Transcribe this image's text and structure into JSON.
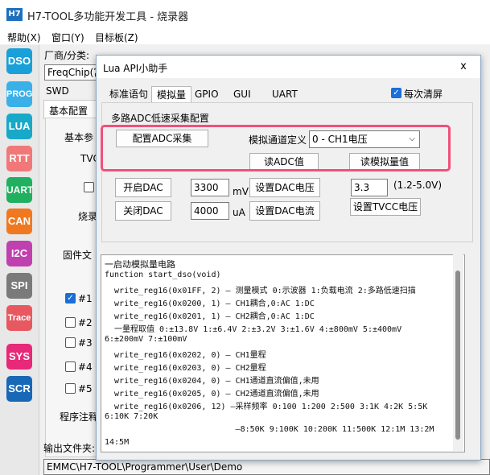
{
  "window": {
    "icon_text": "H7",
    "title": "H7-TOOL多功能开发工具 - 烧录器"
  },
  "menu": [
    "帮助(X)",
    "窗口(Y)",
    "目标板(Z)"
  ],
  "toolbar": [
    {
      "label": "DSO",
      "color": "#1aa0d8"
    },
    {
      "label": "PROG",
      "color": "#3ab0e8"
    },
    {
      "label": "LUA",
      "color": "#18a8c8"
    },
    {
      "label": "RTT",
      "color": "#f07878"
    },
    {
      "label": "UART",
      "color": "#20b060"
    },
    {
      "label": "CAN",
      "color": "#f07820"
    },
    {
      "label": "I2C",
      "color": "#c040b0"
    },
    {
      "label": "SPI",
      "color": "#7a7a7a"
    },
    {
      "label": "Trace",
      "color": "#e85860"
    },
    {
      "label": "SYS",
      "color": "#e82878"
    },
    {
      "label": "SCR",
      "color": "#1868b8"
    }
  ],
  "background": {
    "vendor_label": "厂商/分类:",
    "vendor_value": "FreqChip(富",
    "swd": "SWD",
    "basic_config_tab": "基本配置",
    "basic_param": "基本参",
    "tvc": "TVC",
    "burn": "烧录",
    "firmware": "固件文",
    "items": [
      "#1",
      "#2",
      "#3",
      "#4",
      "#5"
    ],
    "program_note": "程序注释",
    "output_folder": "输出文件夹:",
    "path": "EMMC\\H7-TOOL\\Programmer\\User\\Demo"
  },
  "dialog": {
    "title": "Lua API小助手",
    "close": "x",
    "tabs": [
      "标准语句",
      "模拟量",
      "GPIO",
      "GUI",
      "UART"
    ],
    "active_tab": "模拟量",
    "clear_each": "每次清屏",
    "group_title": "多路ADC低速采集配置",
    "config_adc": "配置ADC采集",
    "channel_label": "模拟通道定义",
    "channel_value": "0 - CH1电压",
    "read_adc": "读ADC值",
    "read_analog": "读模拟量值",
    "open_dac": "开启DAC",
    "close_dac": "关闭DAC",
    "dac_voltage": "3300",
    "unit_mv": "mV",
    "dac_current": "4000",
    "unit_ua": "uA",
    "set_dac_voltage": "设置DAC电压",
    "set_dac_current": "设置DAC电流",
    "tvcc_value": "3.3",
    "tvcc_range": "(1.2-5.0V)",
    "set_tvcc": "设置TVCC电压",
    "code": [
      "一启动模拟量电路",
      "function start_dso(void)",
      "  write_reg16(0x01FF, 2) — 测量模式 0:示波器 1:负载电流 2:多路低速扫描",
      "  write_reg16(0x0200, 1) — CH1耦合,0:AC 1:DC",
      "  write_reg16(0x0201, 1) — CH2耦合,0:AC 1:DC",
      "  一量程取值 0:±13.8V 1:±6.4V 2:±3.2V 3:±1.6V 4:±800mV 5:±400mV",
      "6:±200mV 7:±100mV",
      "  write_reg16(0x0202, 0) — CH1量程",
      "  write_reg16(0x0203, 0) — CH2量程",
      "  write_reg16(0x0204, 0) — CH1通道直流偏值,未用",
      "  write_reg16(0x0205, 0) — CH2通道直流偏值,未用",
      "  write_reg16(0x0206, 12) —采样频率 0:100 1:200 2:500 3:1K 4:2K 5:5K",
      "6:10K 7:20K",
      "                           —8:50K 9:100K 10:200K 11:500K 12:1M 13:2M",
      "14:5M"
    ]
  }
}
